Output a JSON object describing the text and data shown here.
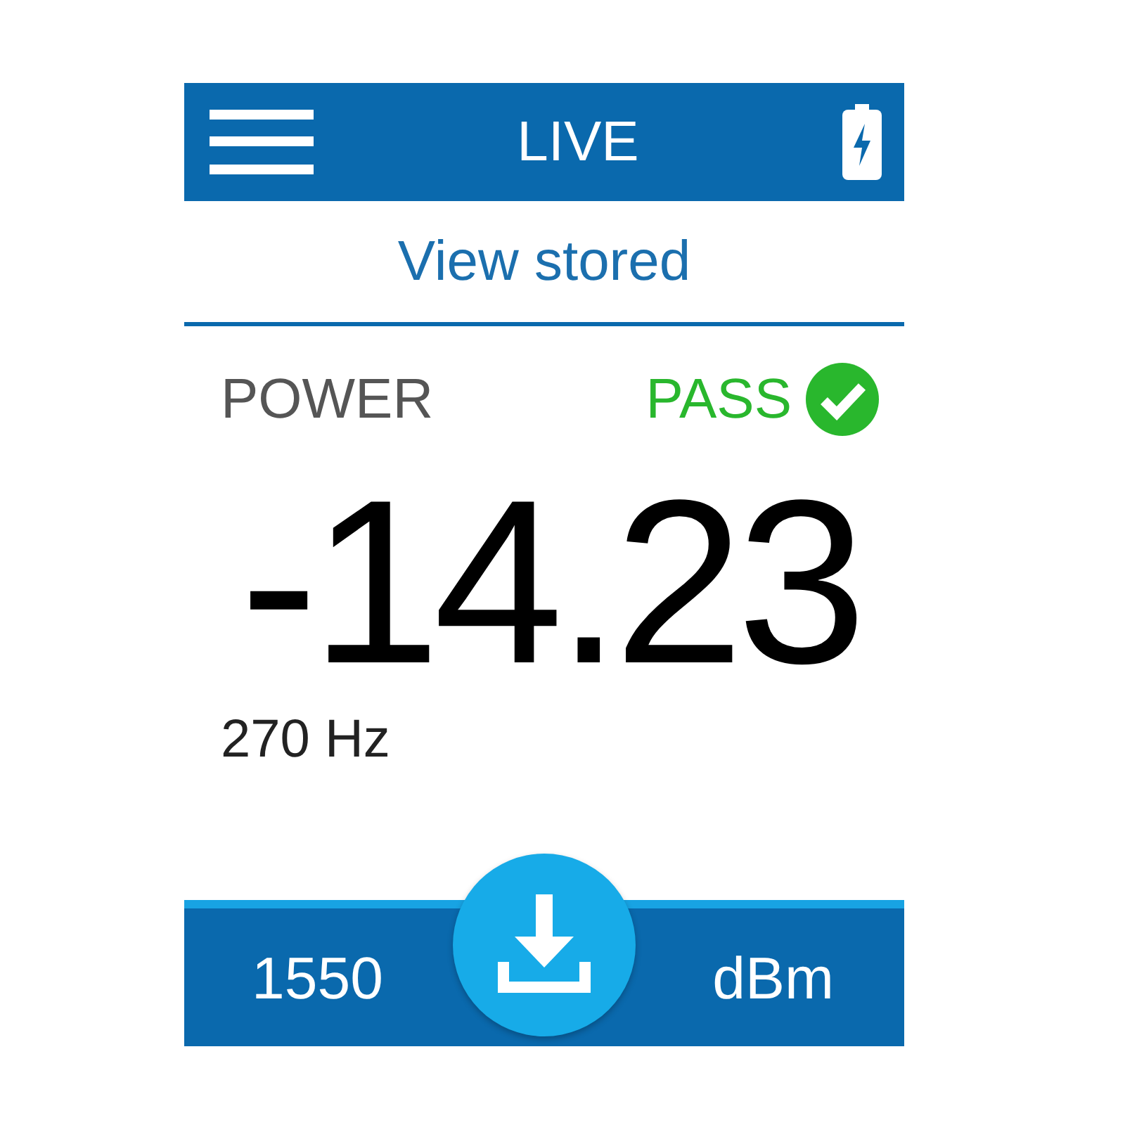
{
  "header": {
    "title": "LIVE"
  },
  "link": "View stored",
  "measurement": {
    "label": "POWER",
    "status": {
      "label": "PASS",
      "kind": "pass"
    },
    "value": "-14.23",
    "frequency": "270 Hz"
  },
  "footer": {
    "wavelength": "1550",
    "unit": "dBm"
  }
}
